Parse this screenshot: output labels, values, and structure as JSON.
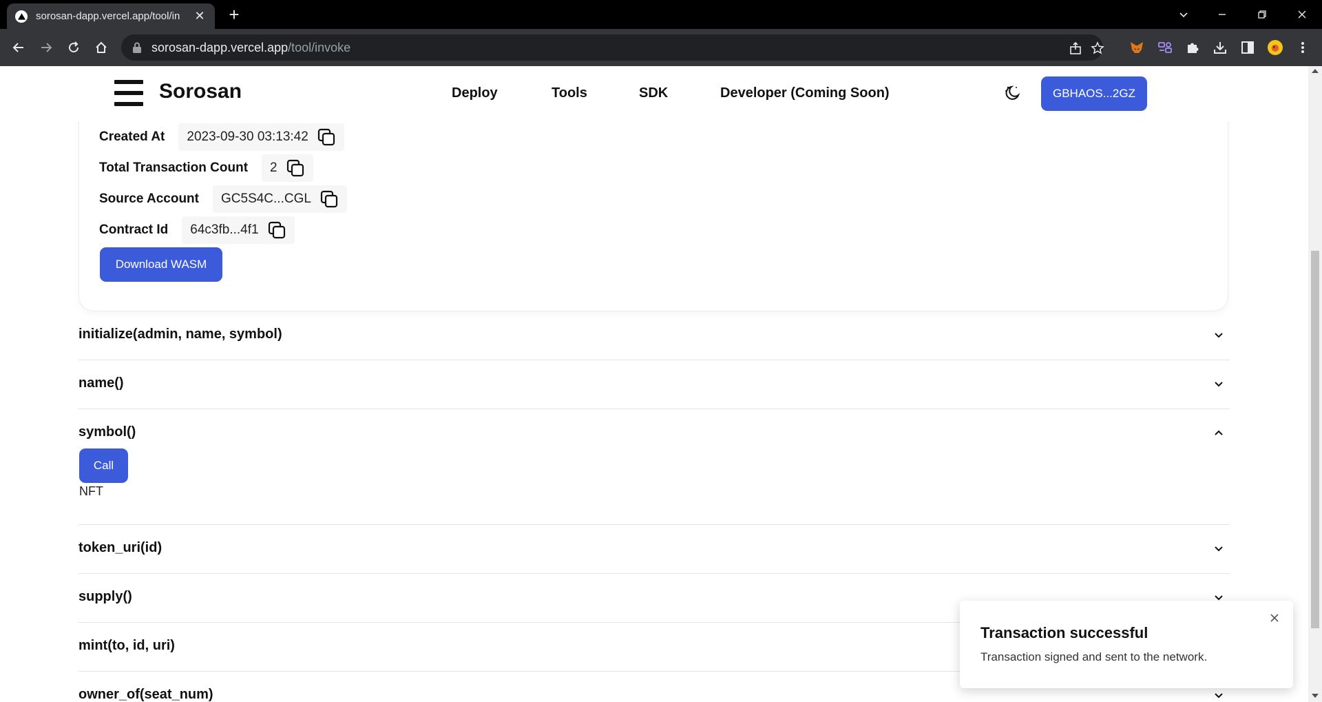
{
  "browser": {
    "tab_title": "sorosan-dapp.vercel.app/tool/in",
    "url_host": "sorosan-dapp.vercel.app",
    "url_path": "/tool/invoke",
    "icons": [
      "back-arrow-icon",
      "forward-arrow-icon",
      "reload-icon",
      "home-icon",
      "lock-icon",
      "share-icon",
      "star-icon",
      "metamask-icon",
      "extension-icon",
      "puzzle-icon",
      "download-icon",
      "sidepanel-icon",
      "profile-avatar",
      "kebab-menu-icon"
    ]
  },
  "header": {
    "logo_text": "Sorosan",
    "nav": [
      "Deploy",
      "Tools",
      "SDK",
      "Developer (Coming Soon)"
    ],
    "wallet_label": "GBHAOS...2GZ"
  },
  "contract_info": {
    "rows": [
      {
        "label": "Created At",
        "value": "2023-09-30 03:13:42"
      },
      {
        "label": "Total Transaction Count",
        "value": "2"
      },
      {
        "label": "Source Account",
        "value": "GC5S4C...CGL"
      },
      {
        "label": "Contract Id",
        "value": "64c3fb...4f1"
      }
    ],
    "download_label": "Download WASM"
  },
  "functions": [
    {
      "name": "initialize(admin, name, symbol)",
      "expanded": false
    },
    {
      "name": "name()",
      "expanded": false
    },
    {
      "name": "symbol()",
      "expanded": true
    },
    {
      "name": "token_uri(id)",
      "expanded": false
    },
    {
      "name": "supply()",
      "expanded": false
    },
    {
      "name": "mint(to, id, uri)",
      "expanded": false
    },
    {
      "name": "owner_of(seat_num)",
      "expanded": false
    }
  ],
  "symbol_panel": {
    "call_label": "Call",
    "result": "NFT"
  },
  "toast": {
    "title": "Transaction successful",
    "message": "Transaction signed and sent to the network."
  },
  "colors": {
    "accent": "#3b5bdb",
    "chrome_dark": "#35363a"
  }
}
